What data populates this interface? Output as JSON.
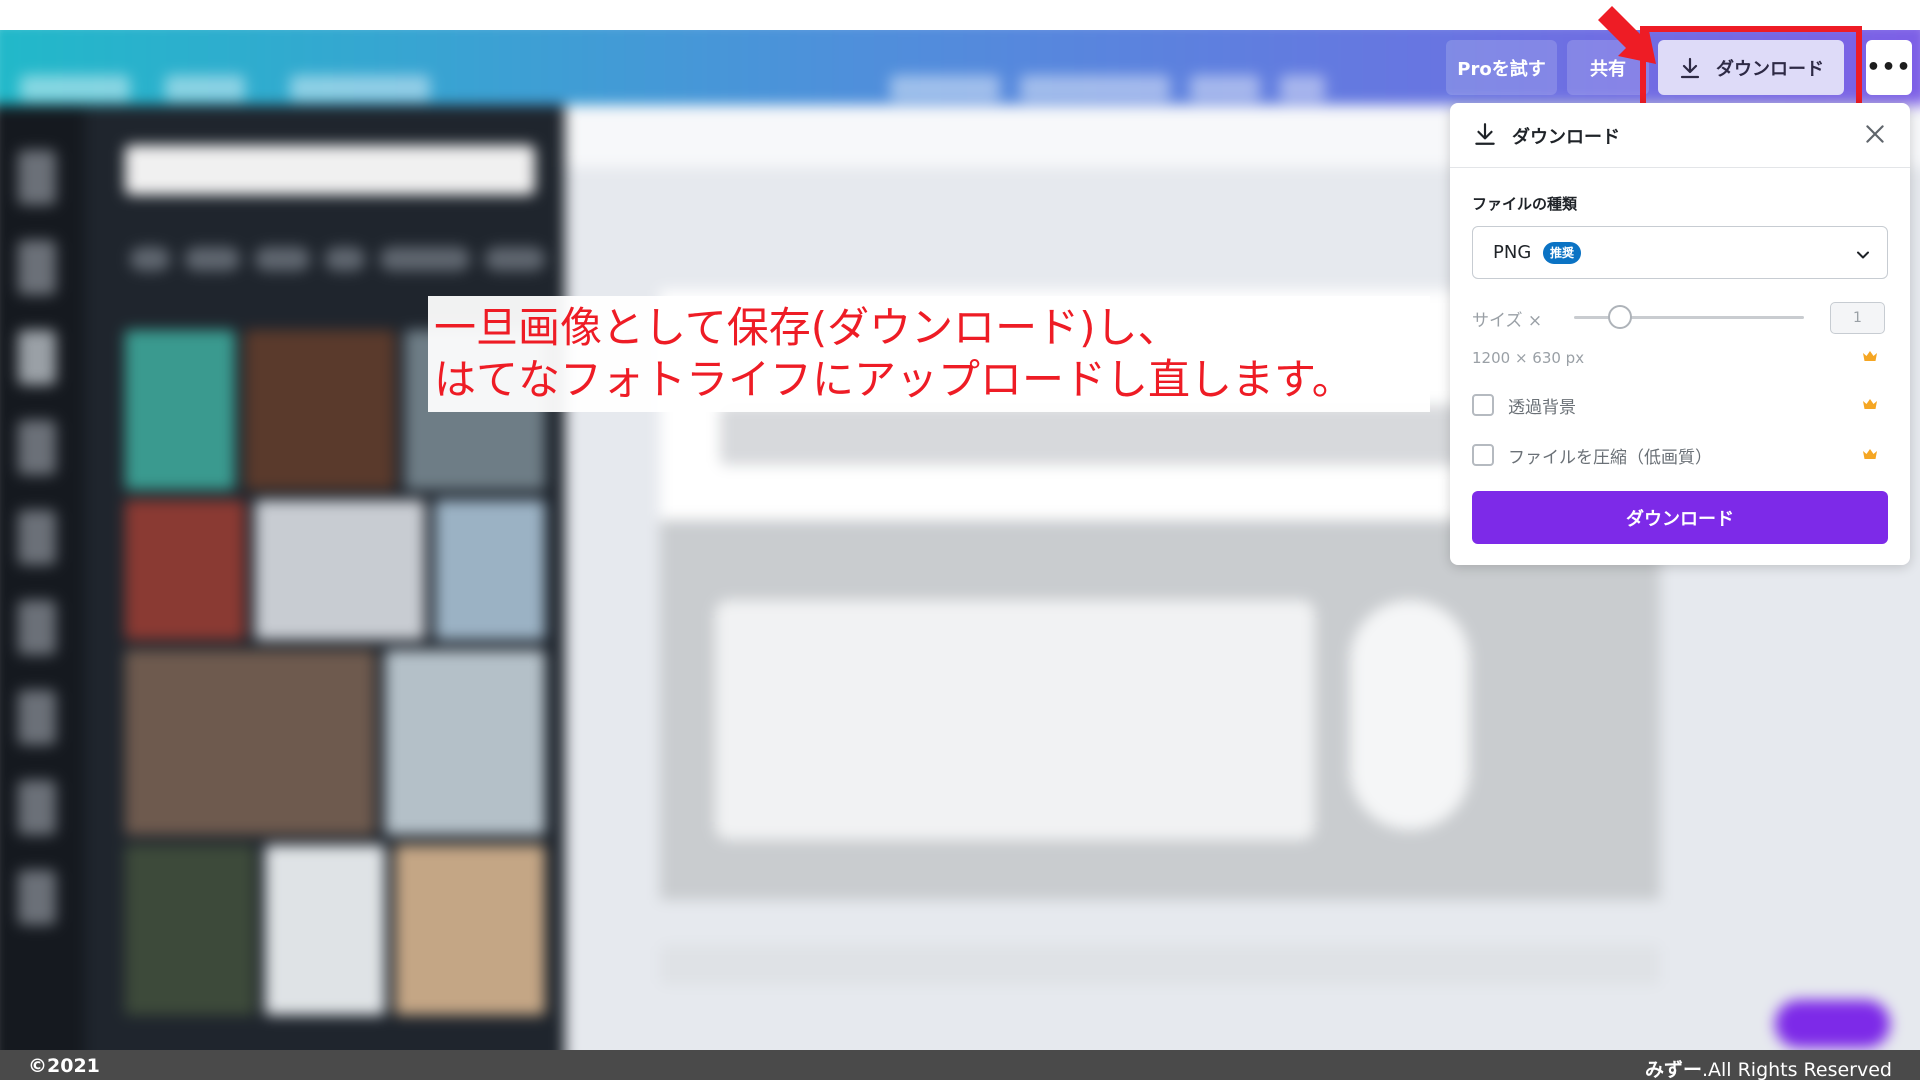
{
  "header": {
    "pro_button": "Proを試す",
    "share_button": "共有",
    "download_button": "ダウンロード",
    "more_button": "•••"
  },
  "download_panel": {
    "title": "ダウンロード",
    "file_type_label": "ファイルの種類",
    "file_type_value": "PNG",
    "recommended_badge": "推奨",
    "size_label": "サイズ ×",
    "size_value": "1",
    "dimensions": "1200 × 630 px",
    "transparent_bg_label": "透過背景",
    "compress_label": "ファイルを圧縮（低画質）",
    "download_button": "ダウンロード",
    "pro_crown_icon": "crown-icon",
    "crown_color": "#f5a623",
    "accent_color": "#7d2ae8",
    "badge_color": "#0b73c4"
  },
  "annotation": {
    "line1": "一旦画像として保存(ダウンロード)し、",
    "line2": "はてなフォトライフにアップロードし直します。",
    "color": "#ee1c25"
  },
  "footer": {
    "copyright": "©2021",
    "author": "みずー",
    "rights": ".All Rights Reserved"
  }
}
